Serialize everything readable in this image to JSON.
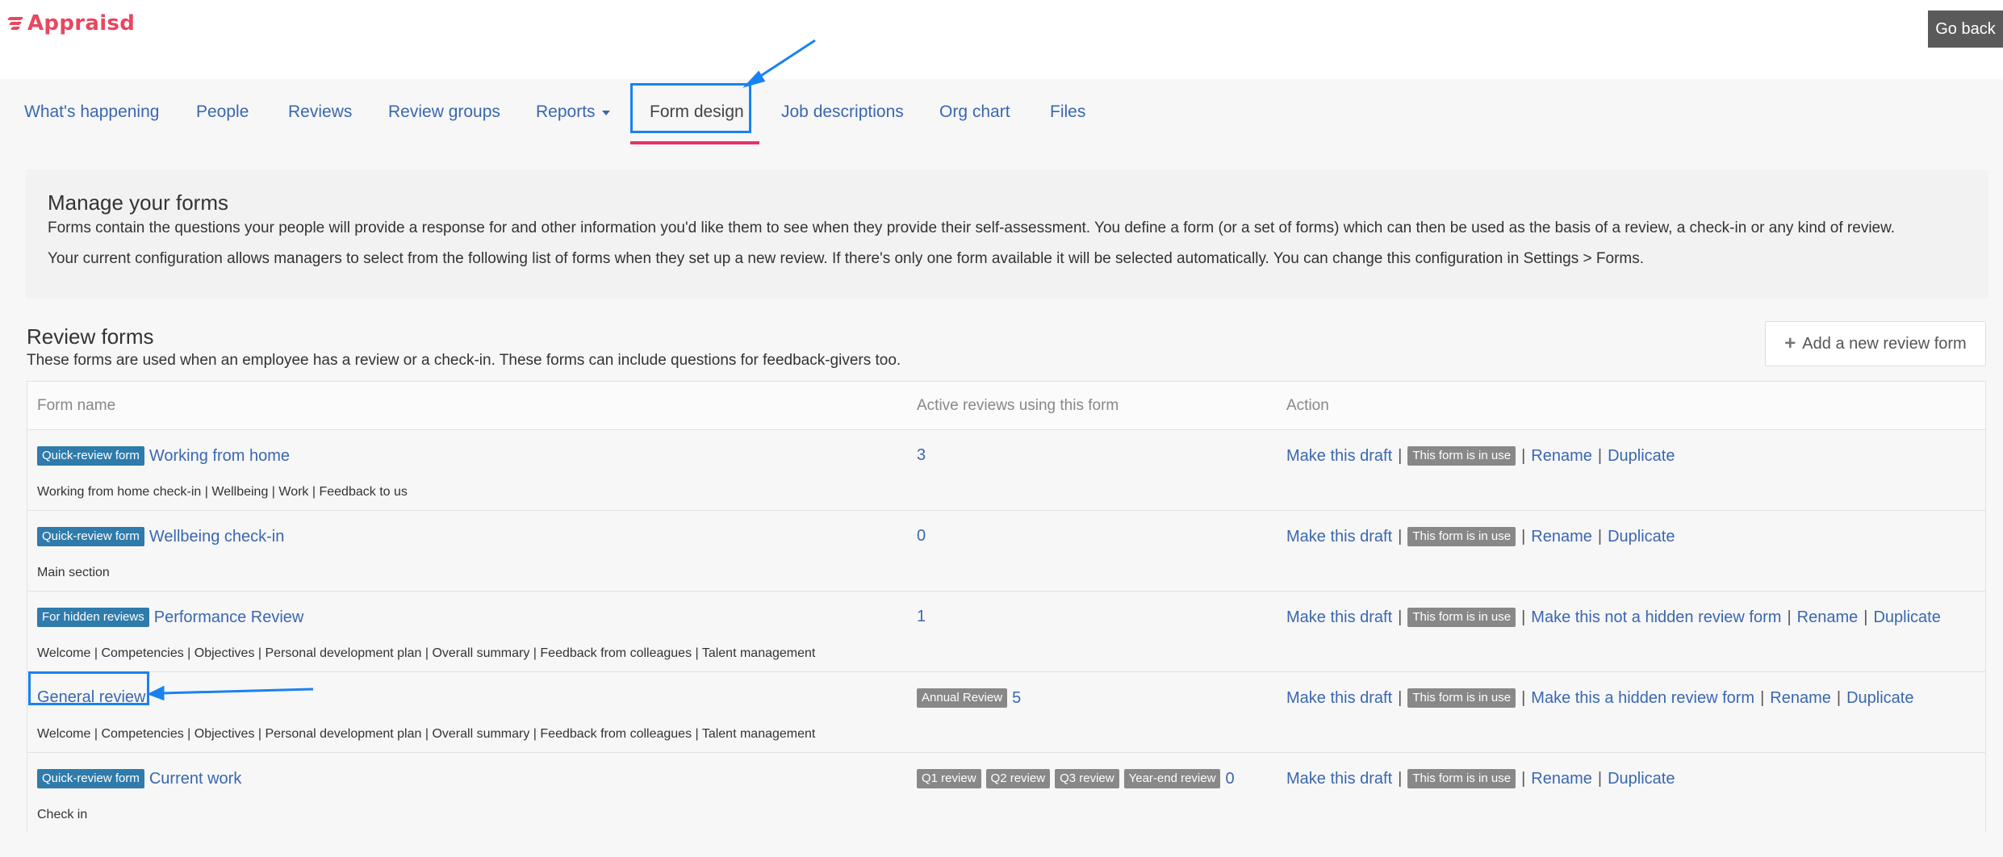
{
  "app": {
    "logo_text": "Appraisd",
    "go_back_label": "Go back"
  },
  "nav": {
    "items": [
      {
        "label": "What's happening"
      },
      {
        "label": "People"
      },
      {
        "label": "Reviews"
      },
      {
        "label": "Review groups"
      },
      {
        "label": "Reports"
      },
      {
        "label": "Form design"
      },
      {
        "label": "Job descriptions"
      },
      {
        "label": "Org chart"
      },
      {
        "label": "Files"
      }
    ],
    "active": "Form design"
  },
  "intro": {
    "title": "Manage your forms",
    "p1": "Forms contain the questions your people will provide a response for and other information you'd like them to see when they provide their self-assessment. You define a form (or a set of forms) which can then be used as the basis of a review, a check-in or any kind of review.",
    "p2": "Your current configuration allows managers to select from the following list of forms when they set up a new review. If there's only one form available it will be selected automatically. You can change this configuration in Settings > Forms."
  },
  "review_forms": {
    "title": "Review forms",
    "description": "These forms are used when an employee has a review or a check-in. These forms can include questions for feedback-givers too.",
    "add_button": "Add a new review form",
    "columns": [
      "Form name",
      "Active reviews using this form",
      "Action"
    ],
    "rows": [
      {
        "badge": "Quick-review form",
        "name": "Working from home",
        "sections": "Working from home check-in | Wellbeing | Work | Feedback to us",
        "review_badges": [],
        "count": "3",
        "actions": [
          "Make this draft",
          "This form is in use",
          "Rename",
          "Duplicate"
        ]
      },
      {
        "badge": "Quick-review form",
        "name": "Wellbeing check-in",
        "sections": "Main section",
        "review_badges": [],
        "count": "0",
        "actions": [
          "Make this draft",
          "This form is in use",
          "Rename",
          "Duplicate"
        ]
      },
      {
        "badge": "For hidden reviews",
        "name": "Performance Review",
        "sections": "Welcome | Competencies | Objectives | Personal development plan | Overall summary | Feedback from colleagues | Talent management",
        "review_badges": [],
        "count": "1",
        "actions": [
          "Make this draft",
          "This form is in use",
          "Make this not a hidden review form",
          "Rename",
          "Duplicate"
        ]
      },
      {
        "badge": "",
        "name": "General review",
        "sections": "Welcome | Competencies | Objectives | Personal development plan | Overall summary | Feedback from colleagues | Talent management",
        "review_badges": [
          "Annual Review"
        ],
        "count": "5",
        "actions": [
          "Make this draft",
          "This form is in use",
          "Make this a hidden review form",
          "Rename",
          "Duplicate"
        ]
      },
      {
        "badge": "Quick-review form",
        "name": "Current work",
        "sections": "Check in",
        "review_badges": [
          "Q1 review",
          "Q2 review",
          "Q3 review",
          "Year-end review"
        ],
        "count": "0",
        "actions": [
          "Make this draft",
          "This form is in use",
          "Rename",
          "Duplicate"
        ]
      }
    ]
  },
  "colors": {
    "brand": "#e8475f",
    "link": "#3a67b0",
    "badge_blue": "#2f7bab",
    "badge_grey": "#888888",
    "annotation": "#1a82f0",
    "active_underline": "#e8316a"
  }
}
